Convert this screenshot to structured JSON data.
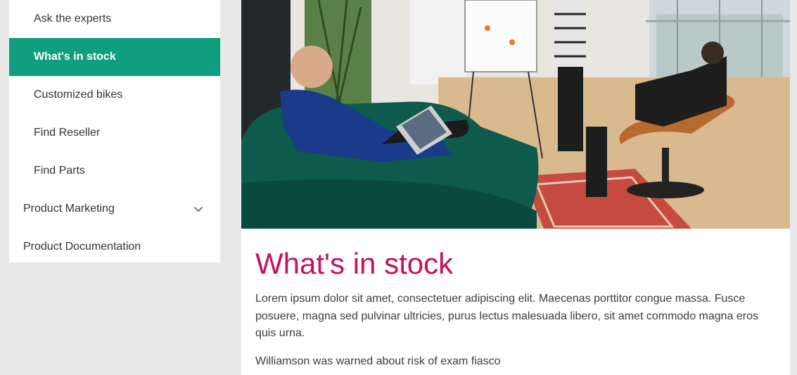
{
  "sidebar": {
    "items": [
      {
        "label": "Ask the experts"
      },
      {
        "label": "What's in stock"
      },
      {
        "label": "Customized bikes"
      },
      {
        "label": "Find Reseller"
      },
      {
        "label": "Find Parts"
      },
      {
        "label": "Product Marketing"
      },
      {
        "label": "Product Documentation"
      }
    ]
  },
  "main": {
    "title": "What's in stock",
    "paragraphs": [
      "Lorem ipsum dolor sit amet, consectetuer adipiscing elit. Maecenas porttitor congue massa. Fusce posuere, magna sed pulvinar ultricies, purus lectus malesuada libero, sit amet commodo magna eros quis urna.",
      "Williamson was warned about risk of exam fiasco"
    ]
  },
  "colors": {
    "accent": "#0f9e80",
    "title": "#c4125d"
  },
  "icons": {
    "expand": "chevron-down-icon"
  }
}
